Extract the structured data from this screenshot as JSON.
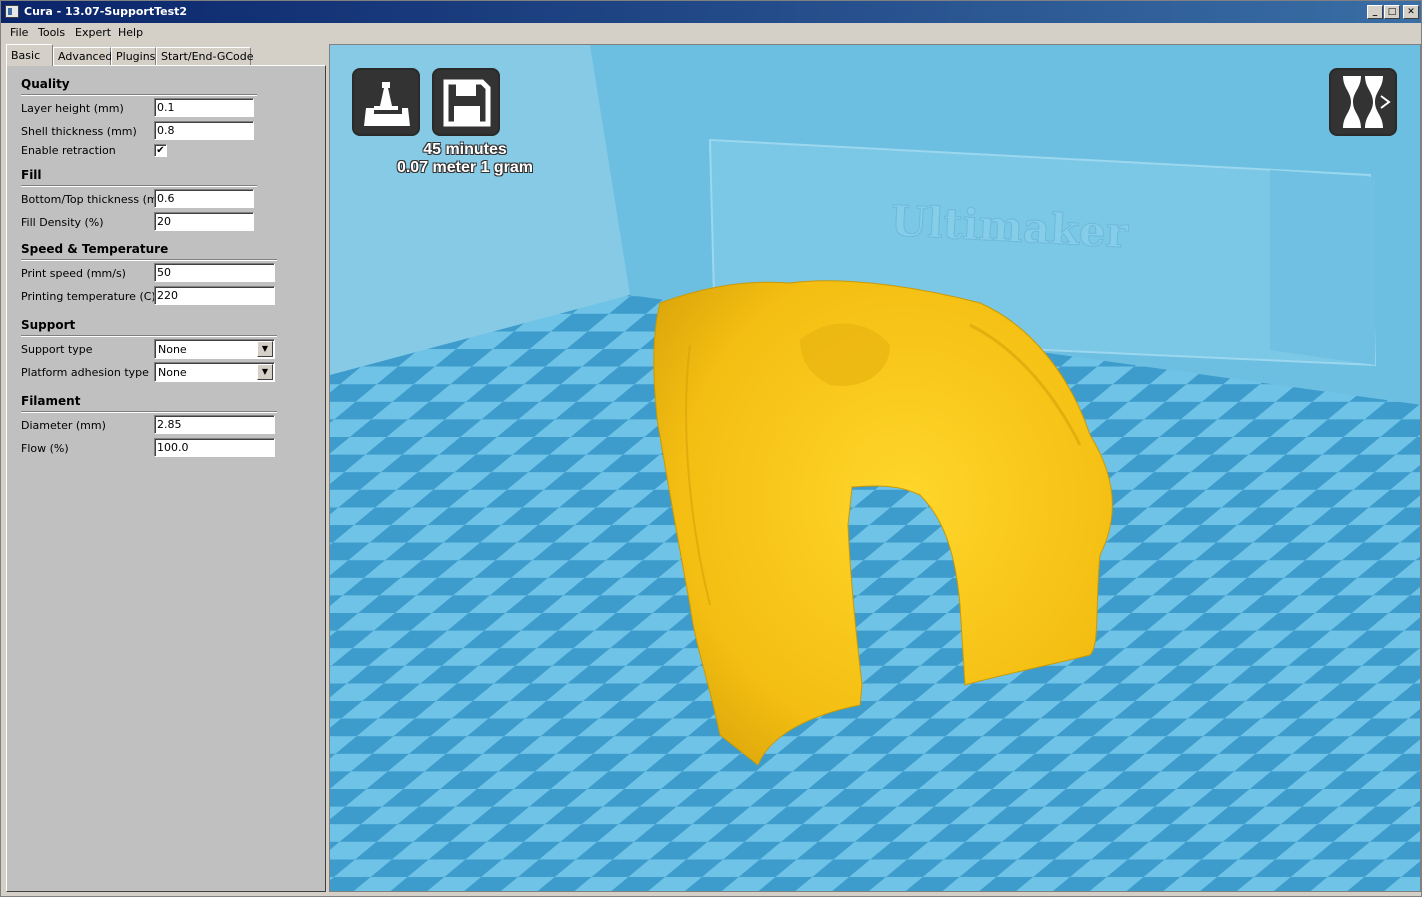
{
  "window": {
    "title": "Cura - 13.07-SupportTest2",
    "controls": [
      "_",
      "□",
      "✕"
    ]
  },
  "menu": [
    "File",
    "Tools",
    "Expert",
    "Help"
  ],
  "tabs": [
    "Basic",
    "Advanced",
    "Plugins",
    "Start/End-GCode"
  ],
  "active_tab": "Basic",
  "sections": {
    "quality": {
      "title": "Quality",
      "layer_height_label": "Layer height (mm)",
      "layer_height_value": "0.1",
      "shell_thickness_label": "Shell thickness (mm)",
      "shell_thickness_value": "0.8",
      "enable_retraction_label": "Enable retraction",
      "enable_retraction_checked": "✔"
    },
    "fill": {
      "title": "Fill",
      "bottom_top_label": "Bottom/Top thickness (mm)",
      "bottom_top_value": "0.6",
      "fill_density_label": "Fill Density (%)",
      "fill_density_value": "20"
    },
    "speed": {
      "title": "Speed & Temperature",
      "print_speed_label": "Print speed (mm/s)",
      "print_speed_value": "50",
      "print_temp_label": "Printing temperature (C)",
      "print_temp_value": "220"
    },
    "support": {
      "title": "Support",
      "support_type_label": "Support type",
      "support_type_value": "None",
      "adhesion_label": "Platform adhesion type",
      "adhesion_value": "None"
    },
    "filament": {
      "title": "Filament",
      "diameter_label": "Diameter (mm)",
      "diameter_value": "2.85",
      "flow_label": "Flow (%)",
      "flow_value": "100.0"
    }
  },
  "viewport": {
    "print_time": "45 minutes",
    "print_material": "0.07 meter 1 gram",
    "backplate_text": "Ultimaker",
    "icons": [
      "load-model-icon",
      "save-gcode-icon",
      "view-mode-icon"
    ],
    "colors": {
      "background": "#7ec6e3",
      "model": "#f7c41a",
      "checker_light": "#6fc3e6",
      "checker_dark": "#3d9ccc"
    }
  }
}
